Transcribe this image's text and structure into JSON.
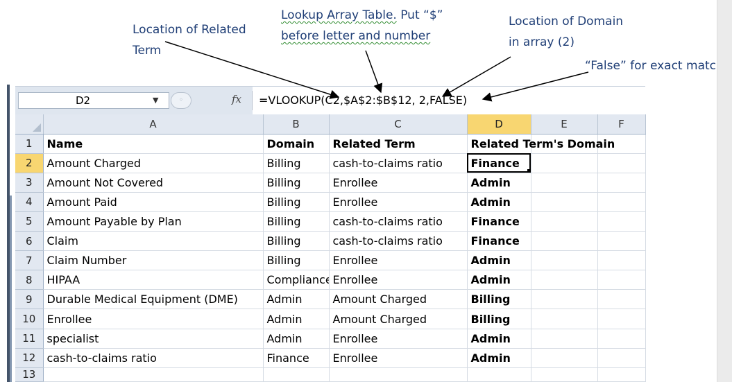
{
  "annotations": {
    "related_term_line1": "Location of Related",
    "related_term_line2": "Term",
    "lookup_prefix": "Lookup Array Table.",
    "lookup_suffix": " Put “$”",
    "lookup_line2": "before letter and number",
    "domain_line1": "Location of Domain",
    "domain_line2": "in array (2)",
    "false_note": "“False” for exact match"
  },
  "formula_bar": {
    "name_box": "D2",
    "fx_label": "fx",
    "formula": "=VLOOKUP(C2,$A$2:$B$12, 2,FALSE)"
  },
  "columns": [
    "A",
    "B",
    "C",
    "D",
    "E",
    "F"
  ],
  "rows": [
    {
      "n": "1",
      "a": "Name",
      "b": "Domain",
      "c": "Related Term",
      "d": "Related Term's Domain"
    },
    {
      "n": "2",
      "a": "Amount Charged",
      "b": "Billing",
      "c": "cash-to-claims ratio",
      "d": "Finance"
    },
    {
      "n": "3",
      "a": "Amount Not Covered",
      "b": "Billing",
      "c": "Enrollee",
      "d": "Admin"
    },
    {
      "n": "4",
      "a": "Amount Paid",
      "b": "Billing",
      "c": "Enrollee",
      "d": "Admin"
    },
    {
      "n": "5",
      "a": "Amount Payable by Plan",
      "b": "Billing",
      "c": "cash-to-claims ratio",
      "d": "Finance"
    },
    {
      "n": "6",
      "a": "Claim",
      "b": "Billing",
      "c": "cash-to-claims ratio",
      "d": "Finance"
    },
    {
      "n": "7",
      "a": "Claim Number",
      "b": "Billing",
      "c": "Enrollee",
      "d": "Admin"
    },
    {
      "n": "8",
      "a": "HIPAA",
      "b": "Compliance",
      "c": "Enrollee",
      "d": "Admin"
    },
    {
      "n": "9",
      "a": "Durable Medical Equipment (DME)",
      "b": "Admin",
      "c": "Amount Charged",
      "d": "Billing"
    },
    {
      "n": "10",
      "a": "Enrollee",
      "b": "Admin",
      "c": "Amount Charged",
      "d": "Billing"
    },
    {
      "n": "11",
      "a": "specialist",
      "b": "Admin",
      "c": "Enrollee",
      "d": "Admin"
    },
    {
      "n": "12",
      "a": "cash-to-claims ratio",
      "b": "Finance",
      "c": "Enrollee",
      "d": "Admin"
    },
    {
      "n": "13",
      "a": "",
      "b": "",
      "c": "",
      "d": ""
    }
  ],
  "colors": {
    "annotation": "#1f3e76",
    "header_bg": "#e2e8f1",
    "selected_header": "#f8d671",
    "formula_bar_bg": "#dfe6ef"
  }
}
